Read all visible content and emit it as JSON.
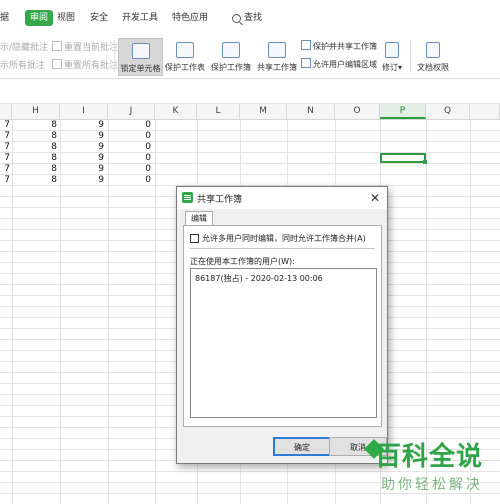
{
  "tabs": {
    "t1": "据",
    "review": "审阅",
    "view": "视图",
    "security": "安全",
    "dev": "开发工具",
    "special": "特色应用",
    "search": "查找"
  },
  "ribbon": {
    "show_hide_comments": "示/隐藏批注",
    "reset_current_comment": "重置当前批注",
    "show_all_comments": "示所有批注",
    "reset_all_comments": "重置所有批注",
    "lock_cell": "锁定单元格",
    "protect_sheet": "保护工作表",
    "protect_workbook": "保护工作簿",
    "share_workbook": "共享工作簿",
    "protect_share_workbook": "保护并共享工作簿",
    "allow_edit_ranges": "允许用户编辑区域",
    "revise": "修订",
    "revise_arrow": "▾",
    "doc_permission": "文档权限"
  },
  "grid": {
    "columns": [
      "H",
      "I",
      "J",
      "K",
      "L",
      "M",
      "N",
      "O",
      "P",
      "Q"
    ],
    "selected_column": "P",
    "rows": [
      [
        "7",
        "8",
        "9",
        "0"
      ],
      [
        "7",
        "8",
        "9",
        "0"
      ],
      [
        "7",
        "8",
        "9",
        "0"
      ],
      [
        "7",
        "8",
        "9",
        "0"
      ],
      [
        "7",
        "8",
        "9",
        "0"
      ],
      [
        "7",
        "8",
        "9",
        "0"
      ]
    ]
  },
  "dialog": {
    "title": "共享工作簿",
    "close": "✕",
    "tab": "编辑",
    "checkbox_label": "允许多用户同时编辑，同时允许工作簿合并(A)",
    "users_label": "正在使用本工作簿的用户(W):",
    "user_entry": "86187(独占) - 2020-02-13 00:06",
    "ok": "确定",
    "cancel": "取消"
  },
  "watermark": {
    "main": "百科全说",
    "sub": "助你轻松解决"
  },
  "colors": {
    "accent": "#36a84a",
    "selection": "#2e9b44",
    "dialog_ok_border": "#2f7cd6"
  }
}
